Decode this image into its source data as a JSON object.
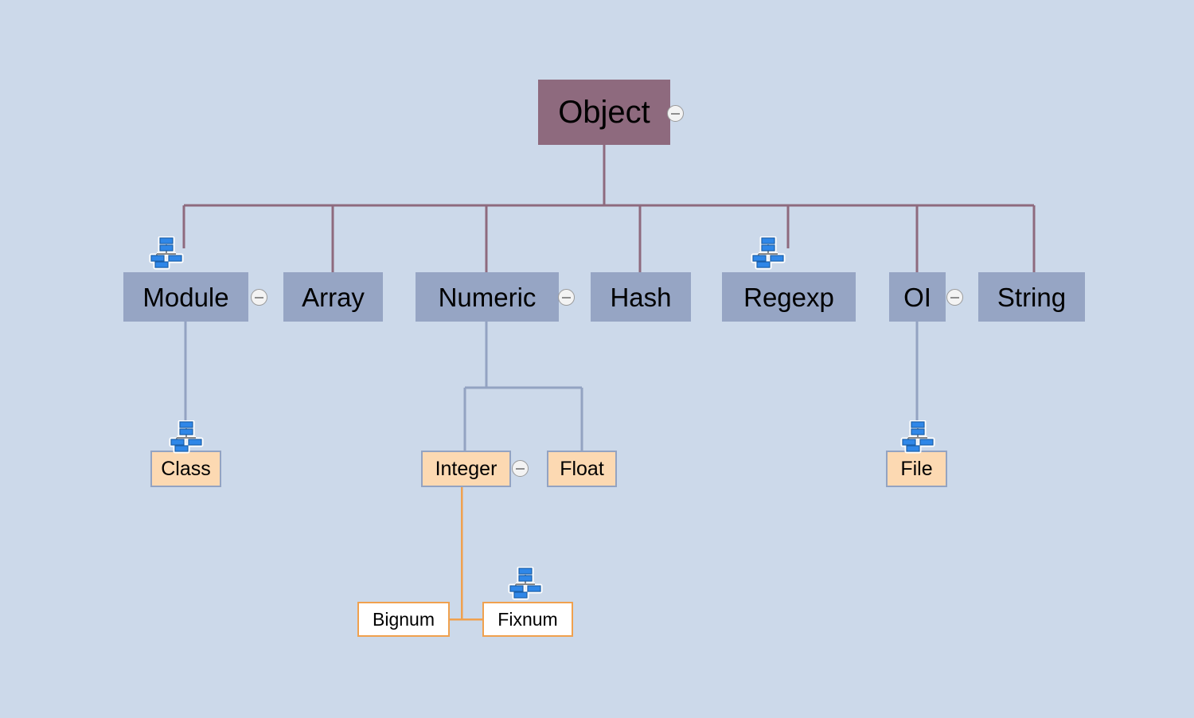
{
  "diagram": {
    "title": "Ruby class hierarchy tree",
    "background_color": "#ccd9ea",
    "colors": {
      "root_fill": "#8e6a7e",
      "level2_fill": "#96a5c4",
      "level3_fill": "#fcd9b2",
      "level3_border": "#93a3c2",
      "level4_fill": "#ffffff",
      "level4_border": "#f0a14e",
      "root_edge": "#8e6a7e",
      "level2_edge": "#93a3c2",
      "level3_edge": "#f0a14e"
    },
    "nodes": {
      "object": {
        "label": "Object"
      },
      "module": {
        "label": "Module"
      },
      "array": {
        "label": "Array"
      },
      "numeric": {
        "label": "Numeric"
      },
      "hash": {
        "label": "Hash"
      },
      "regexp": {
        "label": "Regexp"
      },
      "oi": {
        "label": "OI"
      },
      "string": {
        "label": "String"
      },
      "class": {
        "label": "Class"
      },
      "integer": {
        "label": "Integer"
      },
      "float": {
        "label": "Float"
      },
      "file": {
        "label": "File"
      },
      "bignum": {
        "label": "Bignum"
      },
      "fixnum": {
        "label": "Fixnum"
      }
    },
    "icons": {
      "collapse": "minus-circle-icon",
      "hierarchy": "org-chart-icon"
    }
  }
}
